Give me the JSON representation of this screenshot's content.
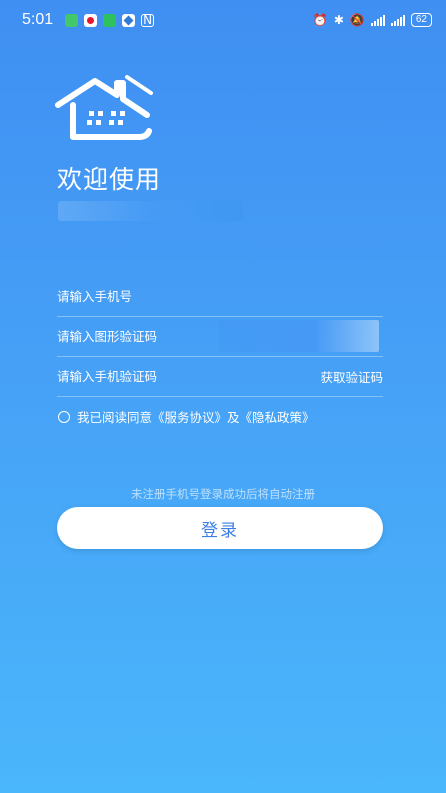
{
  "status_bar": {
    "time": "5:01",
    "battery": "62",
    "app_icons": [
      {
        "name": "msg-app-icon",
        "color": "#43c76b"
      },
      {
        "name": "weibo-icon",
        "color": "#f5a623"
      },
      {
        "name": "wechat-icon",
        "color": "#2dc25b"
      },
      {
        "name": "app-icon",
        "color": "#2f7ad8"
      },
      {
        "name": "nfc-icon",
        "color": "#ffffff"
      }
    ]
  },
  "welcome": {
    "title": "欢迎使用"
  },
  "form": {
    "phone_placeholder": "请输入手机号",
    "captcha_placeholder": "请输入图形验证码",
    "sms_placeholder": "请输入手机验证码",
    "get_code_label": "获取验证码"
  },
  "agreement": {
    "text": "我已阅读同意《服务协议》及《隐私政策》"
  },
  "hint": "未注册手机号登录成功后将自动注册",
  "login_button": "登录",
  "colors": {
    "bg_top": "#3f8ff2",
    "bg_bottom": "#4ab6fb",
    "button_text": "#3b7ee6"
  }
}
